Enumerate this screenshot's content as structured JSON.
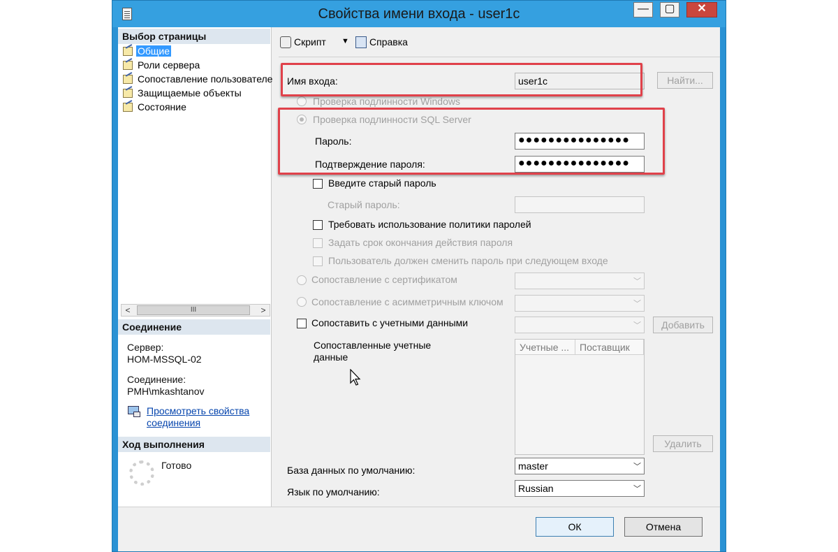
{
  "window": {
    "title": "Свойства имени входа - user1c",
    "minimize_glyph": "—",
    "maximize_glyph": "▢",
    "close_glyph": "✕"
  },
  "left_pane": {
    "select_page_header": "Выбор страницы",
    "pages": [
      {
        "label": "Общие",
        "selected": true
      },
      {
        "label": "Роли сервера",
        "selected": false
      },
      {
        "label": "Сопоставление пользователе",
        "selected": false
      },
      {
        "label": "Защищаемые объекты",
        "selected": false
      },
      {
        "label": "Состояние",
        "selected": false
      }
    ],
    "scroll_left": "<",
    "scroll_right": ">",
    "scroll_thumb": "III",
    "connection_header": "Соединение",
    "server_label": "Сервер:",
    "server_value": "HOM-MSSQL-02",
    "connection_label": "Соединение:",
    "connection_value": "PMH\\mkashtanov",
    "view_props_link_line1": "Просмотреть свойства",
    "view_props_link_line2": "соединения",
    "progress_header": "Ход выполнения",
    "progress_status": "Готово"
  },
  "toolbar": {
    "script_label": "Скрипт",
    "script_dropdown": "▼",
    "help_label": "Справка"
  },
  "form": {
    "login_name_label": "Имя входа:",
    "login_name_value": "user1c",
    "find_button": "Найти...",
    "windows_auth_label": "Проверка подлинности Windows",
    "sql_auth_label": "Проверка подлинности SQL Server",
    "password_label": "Пароль:",
    "password_value": "●●●●●●●●●●●●●●●",
    "confirm_password_label": "Подтверждение пароля:",
    "confirm_password_value": "●●●●●●●●●●●●●●●",
    "old_password_check_label": "Введите старый пароль",
    "old_password_label": "Старый пароль:",
    "old_password_value": "",
    "enforce_policy_label": "Требовать использование политики паролей",
    "enforce_expiration_label": "Задать срок окончания действия пароля",
    "must_change_label": "Пользователь должен сменить пароль при следующем входе",
    "map_cert_label": "Сопоставление с сертификатом",
    "map_asym_key_label": "Сопоставление с асимметричным ключом",
    "map_credentials_label": "Сопоставить с учетными данными",
    "add_button": "Добавить",
    "mapped_credentials_label_line1": "Сопоставленные учетные",
    "mapped_credentials_label_line2": "данные",
    "grid_columns": [
      "Учетные ...",
      "Поставщик"
    ],
    "remove_button": "Удалить",
    "default_db_label": "База данных по умолчанию:",
    "default_db_value": "master",
    "default_lang_label": "Язык по умолчанию:",
    "default_lang_value": "Russian",
    "dropdown_glyph": "﹀"
  },
  "footer": {
    "ok_button": "ОК",
    "cancel_button": "Отмена"
  },
  "colors": {
    "highlight_box": "#e0414a",
    "selection": "#3399ff",
    "titlebar": "#35a0e0"
  }
}
